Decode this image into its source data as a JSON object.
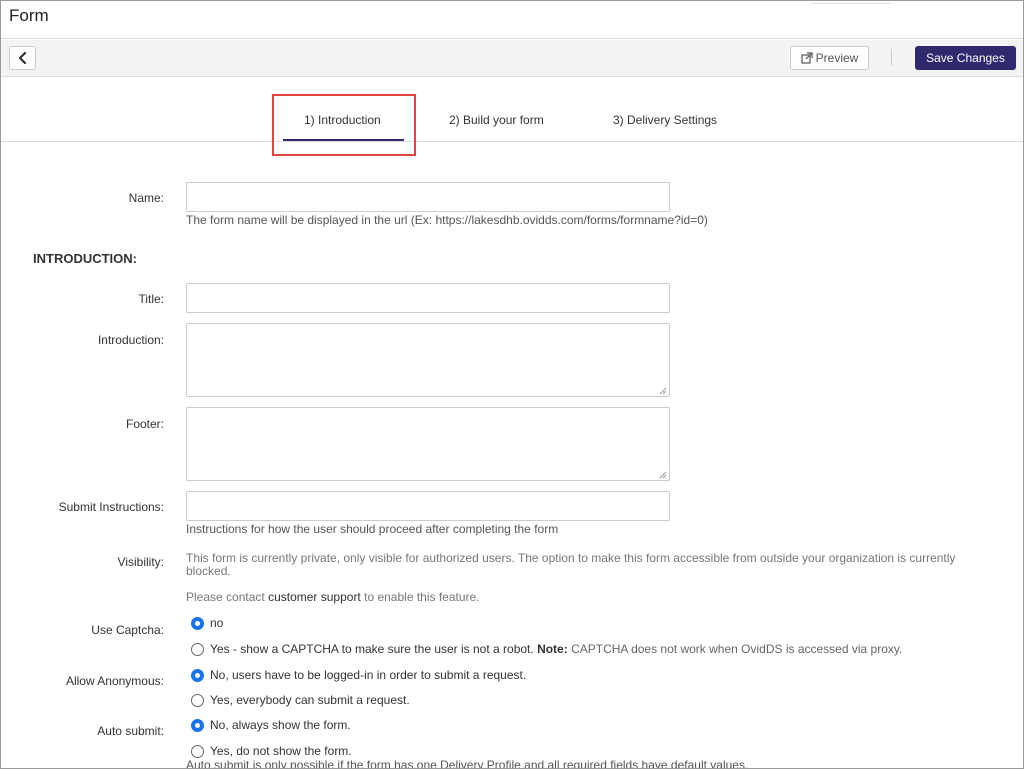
{
  "header": {
    "title": "Form"
  },
  "toolbar": {
    "preview_label": "Preview",
    "save_label": "Save Changes"
  },
  "tabs": [
    {
      "label": "1)  Introduction"
    },
    {
      "label": "2)  Build your form"
    },
    {
      "label": "3)  Delivery Settings"
    }
  ],
  "form": {
    "name": {
      "label": "Name:",
      "value": "",
      "help": "The form name will be displayed in the url (Ex: https://lakesdhb.ovidds.com/forms/formname?id=0)"
    },
    "section_title": "INTRODUCTION:",
    "title": {
      "label": "Title:",
      "value": ""
    },
    "introduction": {
      "label": "Introduction:",
      "value": ""
    },
    "footer": {
      "label": "Footer:",
      "value": ""
    },
    "submit_instructions": {
      "label": "Submit Instructions:",
      "value": "",
      "help": "Instructions for how the user should proceed after completing the form"
    },
    "visibility": {
      "label": "Visibility:",
      "text": "This form is currently private, only visible for authorized users. The option to make this form accessible from outside your organization is currently blocked.",
      "contact_prefix": "Please contact ",
      "contact_link": "customer support",
      "contact_suffix": " to enable this feature."
    },
    "captcha": {
      "label": "Use Captcha:",
      "option_no": "no",
      "option_yes": "Yes - show a CAPTCHA to make sure the user is not a robot.",
      "note_label": "Note:",
      "note_text": " CAPTCHA does not work when OvidDS is accessed via proxy."
    },
    "anonymous": {
      "label": "Allow Anonymous:",
      "option_no": "No, users have to be logged-in in order to submit a request.",
      "option_yes": "Yes, everybody can submit a request."
    },
    "auto_submit": {
      "label": "Auto submit:",
      "option_no": "No, always show the form.",
      "option_yes": "Yes, do not show the form.",
      "help": "Auto submit is only possible if the form has one Delivery Profile and all required fields have default values."
    }
  }
}
